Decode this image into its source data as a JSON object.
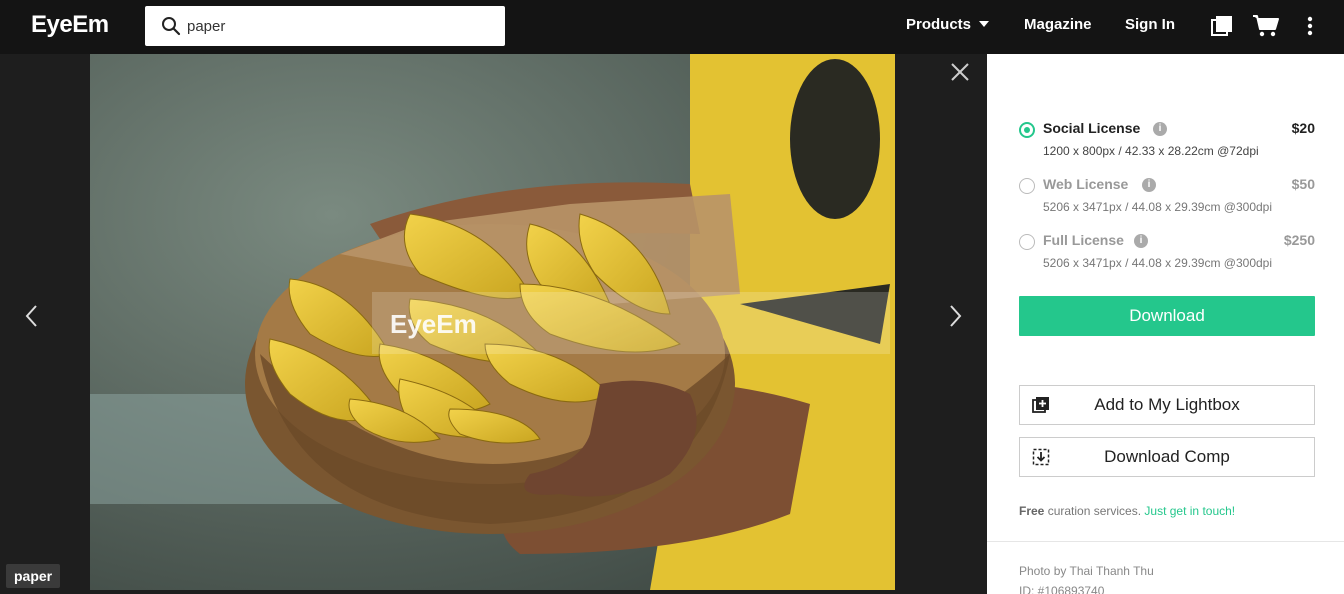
{
  "header": {
    "logo": "EyeEm",
    "search": {
      "value": "paper"
    },
    "nav": {
      "products": "Products",
      "magazine": "Magazine",
      "sign_in": "Sign In"
    },
    "icons": [
      "lightbox-icon",
      "cart-icon",
      "more-vertical-icon"
    ]
  },
  "viewer": {
    "watermark": "EyeEm",
    "tag": "paper",
    "icons": [
      "close-icon",
      "chevron-left-icon",
      "chevron-right-icon"
    ]
  },
  "licenses": [
    {
      "name": "Social License",
      "price": "$20",
      "size": "1200 x 800px / 42.33 x 28.22cm @72dpi",
      "selected": true
    },
    {
      "name": "Web License",
      "price": "$50",
      "size": "5206 x 3471px / 44.08 x 29.39cm @300dpi",
      "selected": false
    },
    {
      "name": "Full License",
      "price": "$250",
      "size": "5206 x 3471px / 44.08 x 29.39cm @300dpi",
      "selected": false
    }
  ],
  "actions": {
    "download": "Download",
    "add_lightbox": "Add to My Lightbox",
    "download_comp": "Download Comp"
  },
  "curation": {
    "free": "Free",
    "text": " curation services. ",
    "link": "Just get in touch!"
  },
  "photo_info": {
    "photo_by": "Photo by Thai Thanh Thu",
    "id": "ID: #106893740"
  },
  "colors": {
    "accent": "#24c78c",
    "topbar": "#141414",
    "viewer_bg": "#1e1e1e"
  }
}
